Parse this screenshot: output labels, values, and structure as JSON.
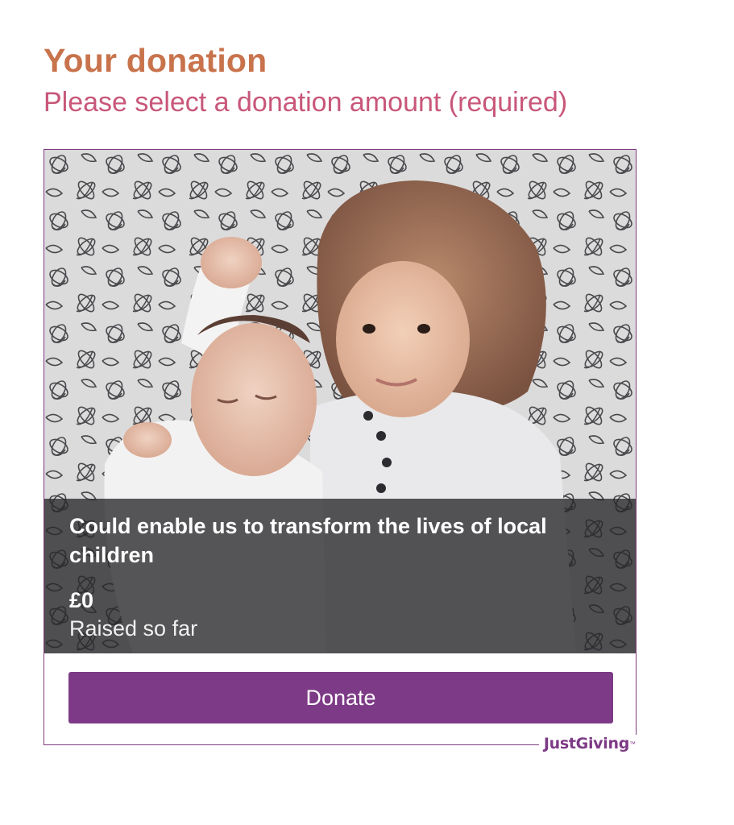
{
  "heading": "Your donation",
  "subheading": "Please select a donation amount (required)",
  "widget": {
    "tagline": "Could enable us to transform the lives of local children",
    "amount_raised": "£0",
    "raised_label": "Raised so far",
    "donate_label": "Donate",
    "brand": "JustGiving",
    "brand_tm": "™"
  },
  "colors": {
    "heading": "#c8734c",
    "subheading": "#c8577a",
    "accent": "#7d3a86"
  }
}
